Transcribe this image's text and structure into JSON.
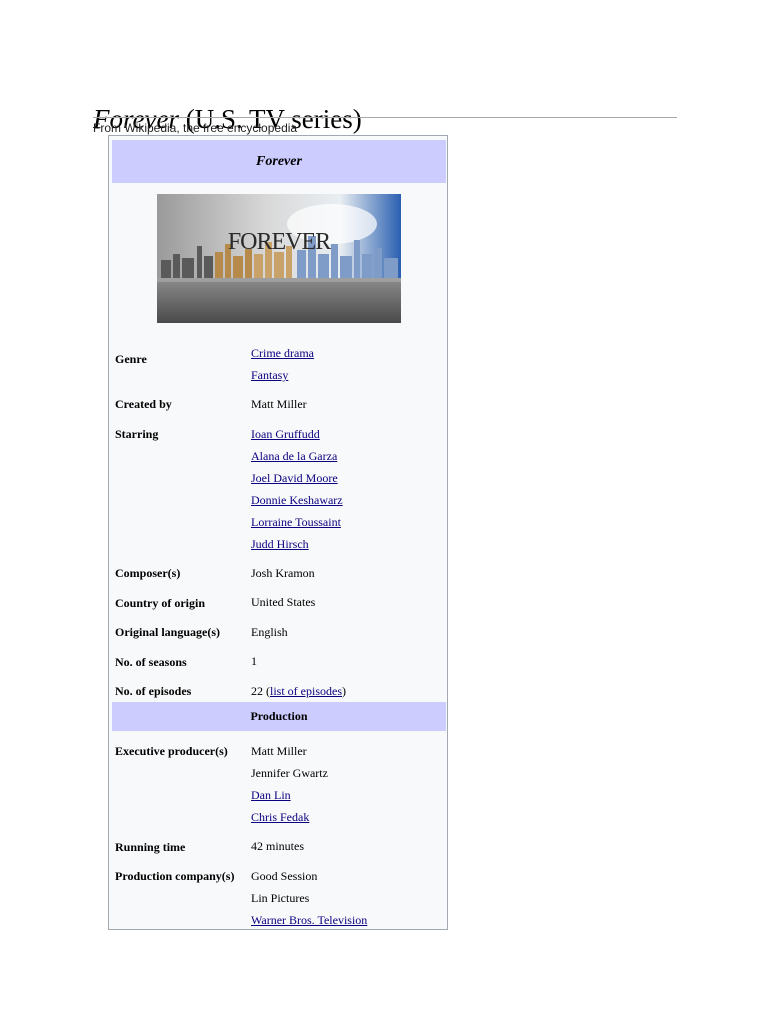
{
  "article": {
    "title_italic": "Forever",
    "title_rest": " (U.S. TV series)",
    "subtitle": "From Wikipedia, the free encyclopedia"
  },
  "infobox": {
    "header": "Forever",
    "image_wordmark": "FOREVER",
    "section_production": "Production",
    "rows": {
      "genre": {
        "label": "Genre",
        "values": [
          "Crime drama",
          "Fantasy"
        ]
      },
      "created_by": {
        "label": "Created by",
        "values": [
          "Matt Miller"
        ]
      },
      "starring": {
        "label": "Starring",
        "values": [
          "Ioan Gruffudd",
          "Alana de la Garza",
          "Joel David Moore",
          "Donnie Keshawarz",
          "Lorraine Toussaint",
          "Judd Hirsch"
        ]
      },
      "composers": {
        "label": "Composer(s)",
        "values": [
          "Josh Kramon"
        ]
      },
      "country": {
        "label": "Country of origin",
        "values": [
          "United States"
        ]
      },
      "language": {
        "label": "Original language(s)",
        "values": [
          "English"
        ]
      },
      "seasons": {
        "label": "No. of seasons",
        "values": [
          "1"
        ]
      },
      "episodes": {
        "label": "No. of episodes",
        "count": "22",
        "open": " (",
        "link": "list of episodes",
        "close": ")"
      },
      "exec_producers": {
        "label": "Executive producer(s)",
        "values": [
          "Matt Miller",
          "Jennifer Gwartz",
          "Dan Lin",
          "Chris Fedak"
        ]
      },
      "running_time": {
        "label": "Running time",
        "values": [
          "42 minutes"
        ]
      },
      "production_companies": {
        "label": "Production company(s)",
        "values": [
          "Good Session",
          "Lin Pictures",
          "Warner Bros. Television"
        ]
      }
    }
  },
  "colors": {
    "link": "#0b0080",
    "infobox_header_bg": "#ccccff",
    "infobox_bg": "#f8f9fa",
    "infobox_border": "#a2a9b1"
  }
}
